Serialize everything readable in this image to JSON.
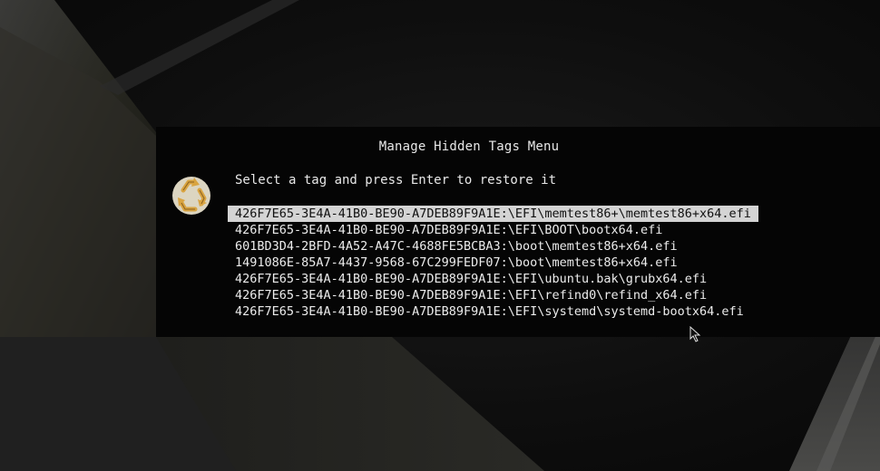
{
  "menu": {
    "title": "Manage Hidden Tags Menu",
    "prompt": "Select a tag and press Enter to restore it",
    "icon": "recycle-restore-icon",
    "selected_index": 0,
    "tags": [
      "426F7E65-3E4A-41B0-BE90-A7DEB89F9A1E:\\EFI\\memtest86+\\memtest86+x64.efi",
      "426F7E65-3E4A-41B0-BE90-A7DEB89F9A1E:\\EFI\\BOOT\\bootx64.efi",
      "601BD3D4-2BFD-4A52-A47C-4688FE5BCBA3:\\boot\\memtest86+x64.efi",
      "1491086E-85A7-4437-9568-67C299FEDF07:\\boot\\memtest86+x64.efi",
      "426F7E65-3E4A-41B0-BE90-A7DEB89F9A1E:\\EFI\\ubuntu.bak\\grubx64.efi",
      "426F7E65-3E4A-41B0-BE90-A7DEB89F9A1E:\\EFI\\refind0\\refind_x64.efi",
      "426F7E65-3E4A-41B0-BE90-A7DEB89F9A1E:\\EFI\\systemd\\systemd-bootx64.efi"
    ]
  },
  "colors": {
    "text": "#ececec",
    "selection_bg": "#d4d4d4",
    "selection_text": "#101010",
    "icon_gold": "#d9a441"
  }
}
